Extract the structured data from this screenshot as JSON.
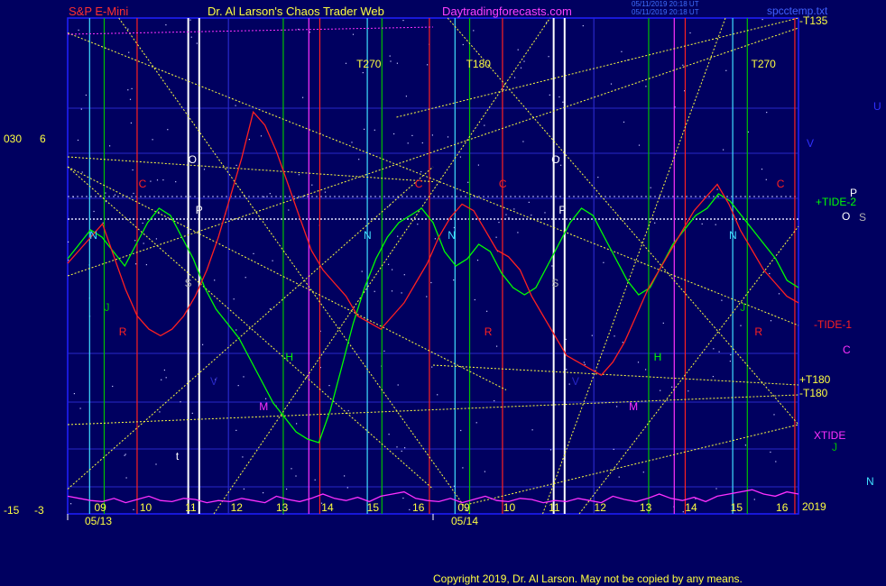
{
  "header": {
    "symbol": "S&P E-Mini",
    "title": "Dr. Al Larson's Chaos Trader Web",
    "site": "Daytradingforecasts.com",
    "stamp1": "05/11/2019 20:18 UT",
    "stamp2": "05/11/2019 20:18 UT",
    "file": "spcctemp.txt"
  },
  "footer": {
    "copyright": "Copyright 2019, Dr. Al Larson. May not be copied by any means."
  },
  "left_axis": {
    "top_a": "030",
    "top_b": "6",
    "bot_a": "-15",
    "bot_b": "-3"
  },
  "right_labels": {
    "T135": "-T135",
    "U": "U",
    "V": "V",
    "P": "P",
    "TIDE2": "+TIDE-2",
    "O": "O",
    "S": "S",
    "TIDE1": "-TIDE-1",
    "C": "C",
    "T180a": "+T180",
    "T180b": "-T180",
    "XTIDE": "XTIDE",
    "J": "J",
    "N": "N",
    "year": "2019"
  },
  "colors": {
    "background": "#000060",
    "plot_border": "#2020ff",
    "grid": "#2828c8",
    "green": "#00ff00",
    "red": "#ff2020",
    "magenta": "#ff30ff",
    "yellow": "#ffff40",
    "white": "#ffffff",
    "cyan": "#40e0ff"
  },
  "chart_data": {
    "type": "line",
    "x_dates": [
      "05/13",
      "05/14"
    ],
    "x_ticks": [
      "09",
      "10",
      "11",
      "12",
      "13",
      "14",
      "15",
      "16",
      "09",
      "10",
      "11",
      "12",
      "13",
      "14",
      "15",
      "16"
    ],
    "grid": true,
    "vertical_markers": [
      {
        "label": "T270"
      },
      {
        "label": "T180"
      },
      {
        "label": "T270"
      }
    ],
    "letters": [
      "N",
      "J",
      "R",
      "C",
      "O",
      "P",
      "S",
      "V",
      "M",
      "H",
      "N",
      "C",
      "t",
      "N",
      "R",
      "C",
      "O",
      "P",
      "S",
      "V",
      "M",
      "H",
      "N",
      "J",
      "R",
      "C"
    ],
    "series": [
      {
        "color": "green",
        "values": [
          52,
          56,
          60,
          58,
          54,
          50,
          56,
          62,
          66,
          64,
          58,
          52,
          44,
          38,
          34,
          30,
          24,
          18,
          12,
          8,
          4,
          2,
          1,
          10,
          22,
          34,
          44,
          52,
          58,
          62,
          64,
          66,
          62,
          54,
          50,
          52,
          56,
          54,
          48,
          44,
          42,
          44,
          50,
          56,
          62,
          66,
          64,
          58,
          52,
          46,
          42,
          44,
          50,
          56,
          60,
          64,
          66,
          70,
          68,
          64,
          60,
          56,
          52,
          46,
          44
        ]
      },
      {
        "color": "red",
        "values": [
          46,
          50,
          54,
          58,
          48,
          38,
          30,
          26,
          24,
          26,
          30,
          36,
          44,
          54,
          66,
          78,
          92,
          88,
          80,
          70,
          60,
          50,
          44,
          40,
          36,
          30,
          28,
          26,
          30,
          34,
          40,
          46,
          54,
          60,
          64,
          62,
          56,
          50,
          48,
          44,
          36,
          30,
          24,
          18,
          16,
          14,
          12,
          16,
          22,
          30,
          38,
          44,
          50,
          56,
          62,
          66,
          70,
          64,
          56,
          50,
          44,
          40,
          36,
          34
        ]
      },
      {
        "color": "magenta",
        "values": [
          8,
          6,
          4,
          3,
          6,
          2,
          5,
          8,
          4,
          3,
          6,
          5,
          2,
          4,
          3,
          6,
          4,
          2,
          8,
          5,
          3,
          6,
          10,
          6,
          4,
          7,
          3,
          8,
          10,
          12,
          6,
          4,
          3,
          6,
          2,
          5,
          8,
          4,
          3,
          6,
          5,
          2,
          4,
          3,
          6,
          4,
          2,
          8,
          5,
          3,
          6,
          10,
          6,
          4,
          7,
          3,
          8,
          10,
          12,
          14,
          10,
          8,
          12,
          10
        ]
      }
    ]
  }
}
